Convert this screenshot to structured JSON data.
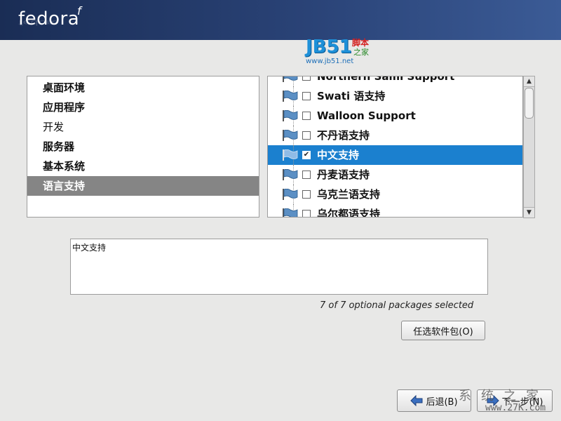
{
  "header": {
    "logo_text": "fedora",
    "logo_mark": "f"
  },
  "watermark_top": {
    "brand": "JB51",
    "red": "脚本",
    "green": "之家",
    "url": "www.jb51.net"
  },
  "categories": [
    {
      "label": "桌面环境"
    },
    {
      "label": "应用程序"
    },
    {
      "label": "开发"
    },
    {
      "label": "服务器"
    },
    {
      "label": "基本系统"
    },
    {
      "label": "语言支持"
    }
  ],
  "selected_category": "语言支持",
  "groups": [
    {
      "label": "Northern Sami Support",
      "checked": false
    },
    {
      "label": "Swati 语支持",
      "checked": false
    },
    {
      "label": "Walloon Support",
      "checked": false
    },
    {
      "label": "不丹语支持",
      "checked": false
    },
    {
      "label": "中文支持",
      "checked": true
    },
    {
      "label": "丹麦语支持",
      "checked": false
    },
    {
      "label": "乌克兰语支持",
      "checked": false
    },
    {
      "label": "乌尔都语支持",
      "checked": false
    }
  ],
  "selected_group": "中文支持",
  "description": "中文支持",
  "status": "7 of 7 optional packages selected",
  "buttons": {
    "optional": "任选软件包(O)",
    "back": "后退(B)",
    "next": "下一步(N)"
  },
  "watermark_bottom": {
    "text": "系统之家",
    "url": "www.27K.com"
  },
  "colors": {
    "header": "#2a4377",
    "selection": "#1b80cf",
    "category_selection": "#858585"
  }
}
